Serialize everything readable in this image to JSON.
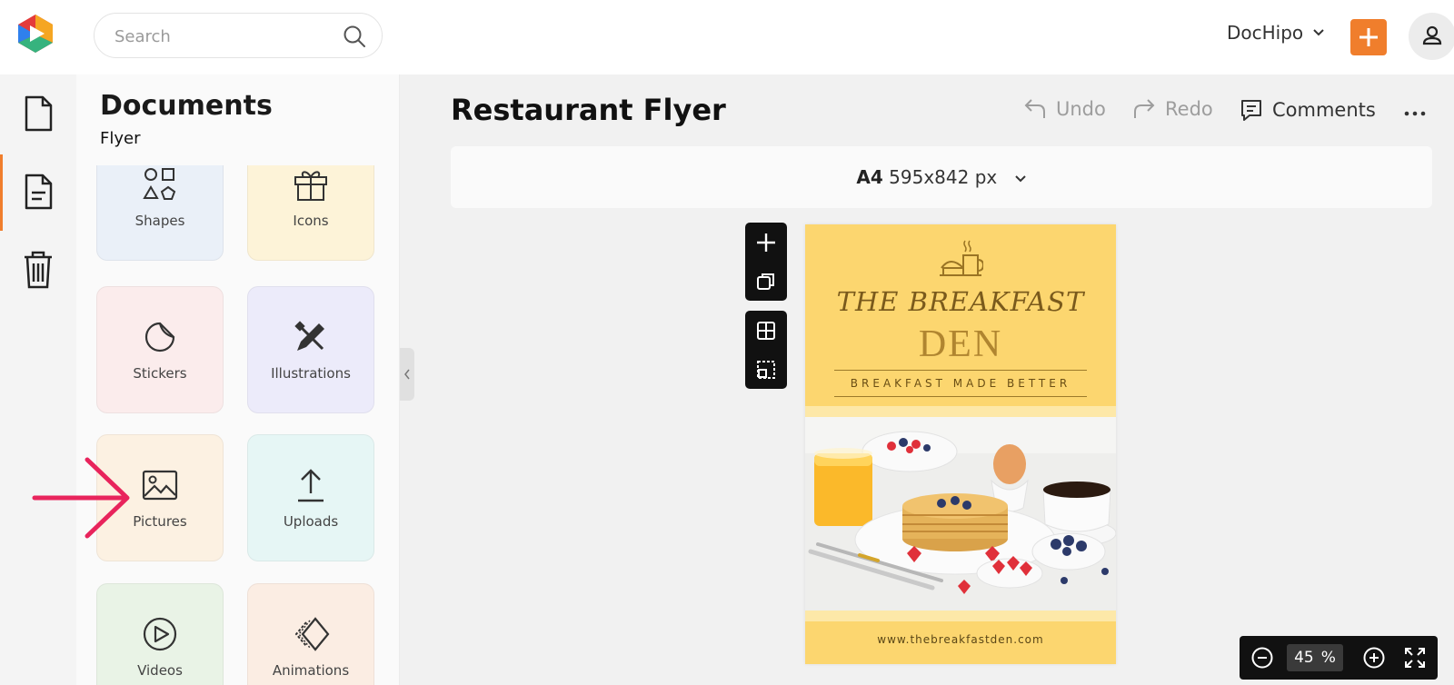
{
  "topbar": {
    "search_placeholder": "Search",
    "account_name": "DocHipo",
    "create_label": "+"
  },
  "rail": {
    "items": [
      {
        "name": "documents",
        "icon": "document-icon"
      },
      {
        "name": "my-designs",
        "icon": "file-text-icon",
        "active": true
      },
      {
        "name": "trash",
        "icon": "trash-icon"
      }
    ]
  },
  "panel": {
    "title": "Documents",
    "subtitle": "Flyer",
    "tiles": [
      {
        "label": "Shapes",
        "icon": "shapes-icon",
        "bg": "#eaf0f8"
      },
      {
        "label": "Icons",
        "icon": "gift-icon",
        "bg": "#fdf3d8"
      },
      {
        "label": "Stickers",
        "icon": "sticker-icon",
        "bg": "#fbecec"
      },
      {
        "label": "Illustrations",
        "icon": "illustration-icon",
        "bg": "#ecebfa"
      },
      {
        "label": "Pictures",
        "icon": "image-icon",
        "bg": "#fcf1e2"
      },
      {
        "label": "Uploads",
        "icon": "upload-icon",
        "bg": "#e6f6f5"
      },
      {
        "label": "Videos",
        "icon": "play-icon",
        "bg": "#e9f3e6"
      },
      {
        "label": "Animations",
        "icon": "animation-icon",
        "bg": "#fbede3"
      }
    ]
  },
  "main": {
    "doc_title": "Restaurant Flyer",
    "undo_label": "Undo",
    "redo_label": "Redo",
    "comments_label": "Comments",
    "size_name": "A4",
    "size_dims": "595x842 px",
    "zoom_value": "45",
    "zoom_unit": "%"
  },
  "flyer": {
    "title_line1": "THE BREAKFAST",
    "title_line2": "DEN",
    "tagline": "BREAKFAST MADE BETTER",
    "url": "www.thebreakfastden.com"
  },
  "colors": {
    "accent": "#f07e2c",
    "flyer_bg": "#fcd66f",
    "arrow": "#e8245c"
  }
}
